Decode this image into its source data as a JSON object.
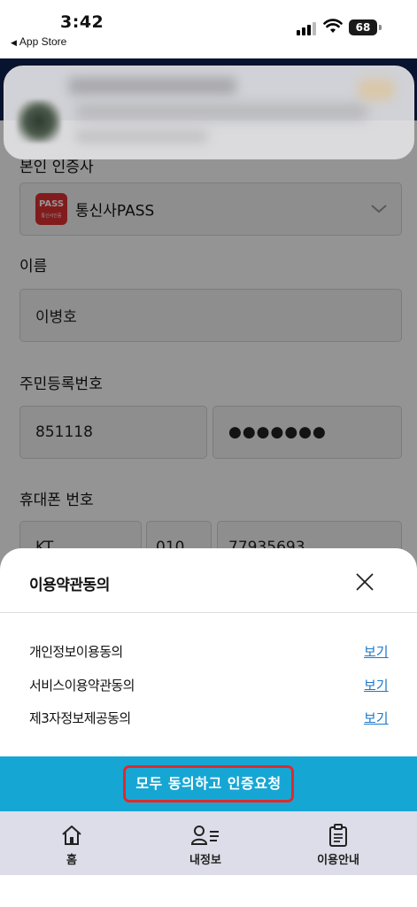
{
  "status_bar": {
    "time": "3:42",
    "back_app": "App Store",
    "battery": "68"
  },
  "form": {
    "carrier_label": "본인 인증사",
    "carrier_logo": "PASS",
    "carrier_logo_sub": "통신사인증",
    "carrier_value": "통신사PASS",
    "name_label": "이름",
    "name_value": "이병호",
    "rrn_label": "주민등록번호",
    "rrn_front": "851118",
    "rrn_back": "●●●●●●●",
    "phone_label": "휴대폰 번호",
    "phone_carrier": "KT",
    "phone_prefix": "010",
    "phone_number": "77935693"
  },
  "sheet": {
    "title": "이용약관동의",
    "terms": [
      {
        "label": "개인정보이용동의",
        "link": "보기"
      },
      {
        "label": "서비스이용약관동의",
        "link": "보기"
      },
      {
        "label": "제3자정보제공동의",
        "link": "보기"
      }
    ],
    "cta_label": "모두 동의하고 인증요청"
  },
  "tab_bar": {
    "tabs": [
      {
        "label": "홈",
        "icon": "home-icon"
      },
      {
        "label": "내정보",
        "icon": "my-info-icon"
      },
      {
        "label": "이용안내",
        "icon": "clipboard-icon"
      }
    ]
  },
  "colors": {
    "header_navy": "#0f2252",
    "cta_blue": "#16a6d4",
    "cta_border_red": "#e02a2a",
    "link_blue": "#1c79c8",
    "tabbar_bg": "#dcdde8"
  }
}
